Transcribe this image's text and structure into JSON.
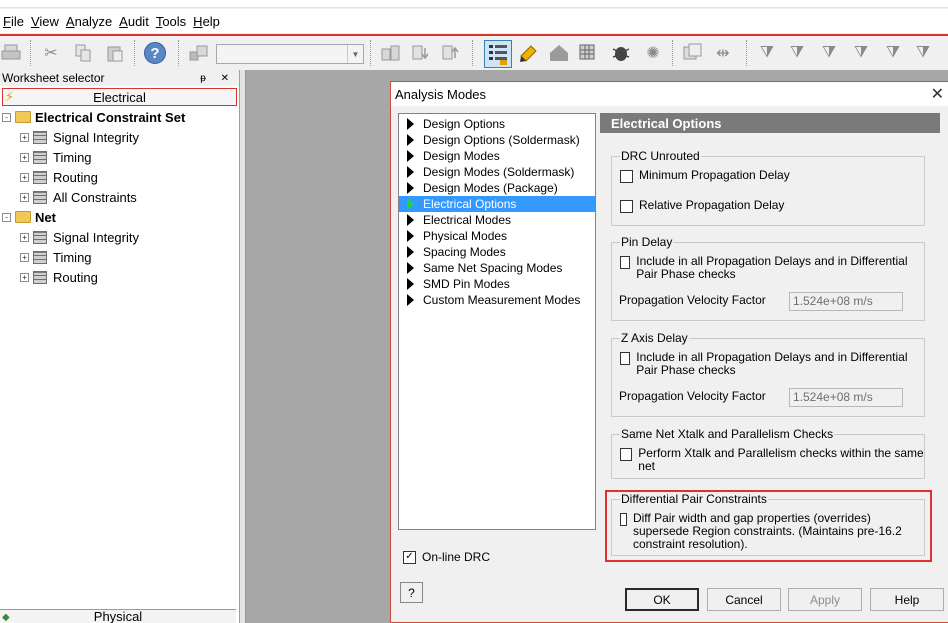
{
  "menu": [
    {
      "label": "File",
      "key": "F",
      "rest": "ile"
    },
    {
      "label": "View",
      "key": "V",
      "rest": "iew"
    },
    {
      "label": "Analyze",
      "key": "A",
      "rest": "nalyze"
    },
    {
      "label": "Audit",
      "key": "A",
      "rest": "udit"
    },
    {
      "label": "Tools",
      "key": "T",
      "rest": "ools"
    },
    {
      "label": "Help",
      "key": "H",
      "rest": "elp"
    }
  ],
  "toolbar": {
    "combo_value": "",
    "help_glyph": "?"
  },
  "worksheet": {
    "header": "Worksheet selector",
    "header_controls": "ᵽ ✕",
    "electrical_tab": "Electrical",
    "physical_tab": "Physical",
    "tree": [
      {
        "label": "Electrical Constraint Set",
        "level": 0,
        "type": "folder",
        "expander": "-"
      },
      {
        "label": "Signal Integrity",
        "level": 1,
        "type": "sheet",
        "expander": "+"
      },
      {
        "label": "Timing",
        "level": 1,
        "type": "sheet",
        "expander": "+"
      },
      {
        "label": "Routing",
        "level": 1,
        "type": "sheet",
        "expander": "+"
      },
      {
        "label": "All Constraints",
        "level": 1,
        "type": "sheet",
        "expander": "+"
      },
      {
        "label": "Net",
        "level": 0,
        "type": "folder",
        "expander": "-"
      },
      {
        "label": "Signal Integrity",
        "level": 1,
        "type": "sheet",
        "expander": "+"
      },
      {
        "label": "Timing",
        "level": 1,
        "type": "sheet",
        "expander": "+"
      },
      {
        "label": "Routing",
        "level": 1,
        "type": "sheet",
        "expander": "+"
      }
    ]
  },
  "dialog": {
    "title": "Analysis Modes",
    "close_glyph": "✕",
    "list": [
      "Design Options",
      "Design Options (Soldermask)",
      "Design Modes",
      "Design Modes (Soldermask)",
      "Design Modes (Package)",
      "Electrical Options",
      "Electrical Modes",
      "Physical Modes",
      "Spacing Modes",
      "Same Net Spacing Modes",
      "SMD Pin Modes",
      "Custom Measurement Modes"
    ],
    "selected_index": 5,
    "online_drc": {
      "label": "On-line DRC",
      "checked": true,
      "check_glyph": "✓"
    },
    "help_q": "?",
    "panel_title": "Electrical Options",
    "drc_unrouted": {
      "legend": "DRC Unrouted",
      "min_prop": "Minimum Propagation Delay",
      "rel_prop": "Relative Propagation Delay"
    },
    "pin_delay": {
      "legend": "Pin Delay",
      "include": "Include in all Propagation Delays and in Differential Pair Phase checks",
      "velocity_label": "Propagation Velocity Factor",
      "velocity_value": "1.524e+08 m/s"
    },
    "z_axis": {
      "legend": "Z Axis Delay",
      "include": "Include in all Propagation Delays and in Differential Pair Phase checks",
      "velocity_label": "Propagation Velocity Factor",
      "velocity_value": "1.524e+08 m/s"
    },
    "xtalk": {
      "legend": "Same Net Xtalk and Parallelism Checks",
      "perform": "Perform Xtalk and Parallelism checks within the same net"
    },
    "diff_pair": {
      "legend": "Differential Pair Constraints",
      "option": "Diff Pair width and gap properties (overrides) supersede Region constraints. (Maintains pre-16.2 constraint resolution)."
    },
    "buttons": {
      "ok": "OK",
      "cancel": "Cancel",
      "apply": "Apply",
      "help": "Help"
    }
  }
}
